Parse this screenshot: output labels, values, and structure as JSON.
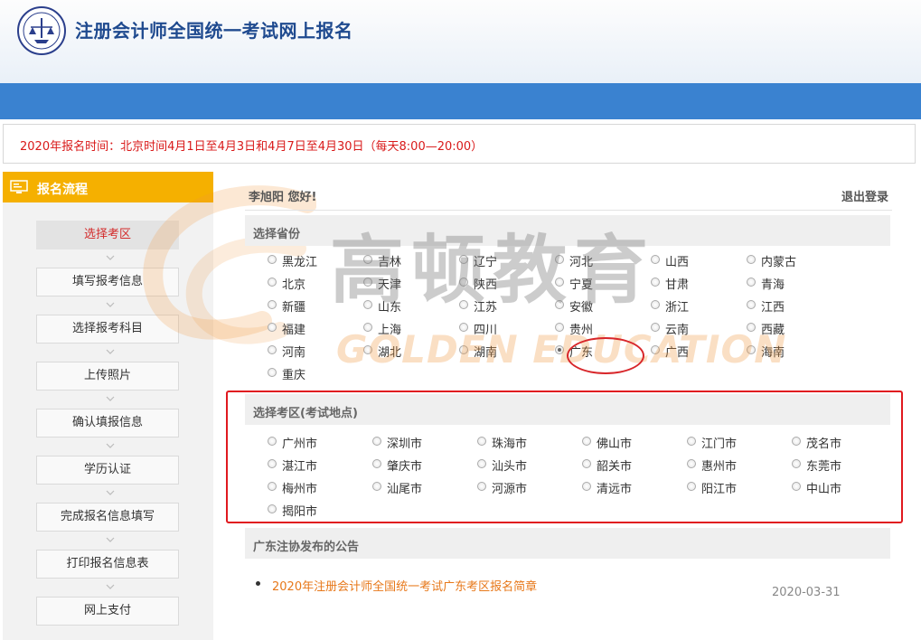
{
  "header": {
    "title": "注册会计师全国统一考试网上报名"
  },
  "notice": {
    "text": "2020年报名时间：北京时间4月1日至4月3日和4月7日至4月30日（每天8:00—20:00）"
  },
  "sidebar": {
    "title": "报名流程",
    "steps": [
      {
        "label": "选择考区",
        "active": true
      },
      {
        "label": "填写报考信息"
      },
      {
        "label": "选择报考科目"
      },
      {
        "label": "上传照片"
      },
      {
        "label": "确认填报信息"
      },
      {
        "label": "学历认证"
      },
      {
        "label": "完成报名信息填写"
      },
      {
        "label": "打印报名信息表"
      },
      {
        "label": "网上支付"
      }
    ]
  },
  "user": {
    "greeting": "李旭阳 您好!",
    "logout": "退出登录"
  },
  "province_section": {
    "title": "选择省份",
    "selected": "广东",
    "options": [
      "黑龙江",
      "吉林",
      "辽宁",
      "河北",
      "山西",
      "内蒙古",
      "北京",
      "天津",
      "陕西",
      "宁夏",
      "甘肃",
      "青海",
      "新疆",
      "山东",
      "江苏",
      "安徽",
      "浙江",
      "江西",
      "福建",
      "上海",
      "四川",
      "贵州",
      "云南",
      "西藏",
      "河南",
      "湖北",
      "湖南",
      "广东",
      "广西",
      "海南",
      "重庆"
    ]
  },
  "exam_area_section": {
    "title": "选择考区(考试地点)",
    "options": [
      "广州市",
      "深圳市",
      "珠海市",
      "佛山市",
      "江门市",
      "茂名市",
      "湛江市",
      "肇庆市",
      "汕头市",
      "韶关市",
      "惠州市",
      "东莞市",
      "梅州市",
      "汕尾市",
      "河源市",
      "清远市",
      "阳江市",
      "中山市",
      "揭阳市"
    ]
  },
  "announcement_section": {
    "title": "广东注协发布的公告",
    "items": [
      {
        "title": "2020年注册会计师全国统一考试广东考区报名简章",
        "date": "2020-03-31"
      }
    ]
  },
  "watermark": {
    "cn": "高顿教育",
    "en": "GOLDEN EDUCATION"
  },
  "colors": {
    "blue_bar": "#3a82d0",
    "sidebar_header": "#f5b000",
    "notice_text": "#d91a1a",
    "annotation_red": "#e0191f",
    "link_orange": "#e7781a"
  }
}
